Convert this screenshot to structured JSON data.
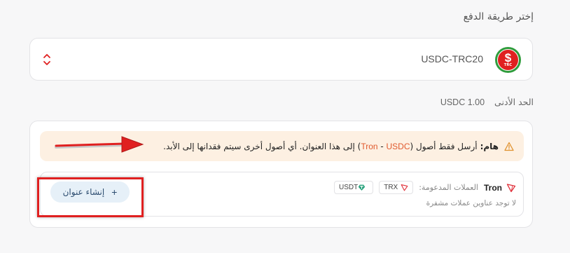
{
  "page": {
    "section_title": "إختر طريقة الدفع"
  },
  "selector": {
    "coin_name": "USDC-TRC20",
    "logo_symbol": "$",
    "logo_sub": "TRC",
    "logo_color": "#e02020",
    "logo_ring_color": "#2f9c3c",
    "sort_icon": "chevron-up-down-icon"
  },
  "minimum": {
    "label": "الحد الأدنى",
    "amount": "1.00 USDC"
  },
  "warning": {
    "icon": "warning-icon",
    "bold_label": "هام:",
    "text_before": "أرسل فقط أصول (",
    "tag_network": "Tron",
    "tag_separator": " - ",
    "tag_coin": "USDC",
    "text_after": ") إلى هذا العنوان. أي أصول أخرى سيتم فقدانها إلى الأبد.",
    "accent_color": "#e15a2e"
  },
  "address": {
    "network_label": "Tron",
    "supported_label": "العملات المدعومة:",
    "chips": [
      {
        "label": "TRX",
        "icon": "tron-icon"
      },
      {
        "label": "USDT",
        "icon": "tether-icon"
      }
    ],
    "empty_text": "لا توجد عناوين عملات مشفرة",
    "create_button": "إنشاء عنوان",
    "create_icon": "+"
  },
  "annotations": {
    "highlight_color": "#e02020"
  }
}
